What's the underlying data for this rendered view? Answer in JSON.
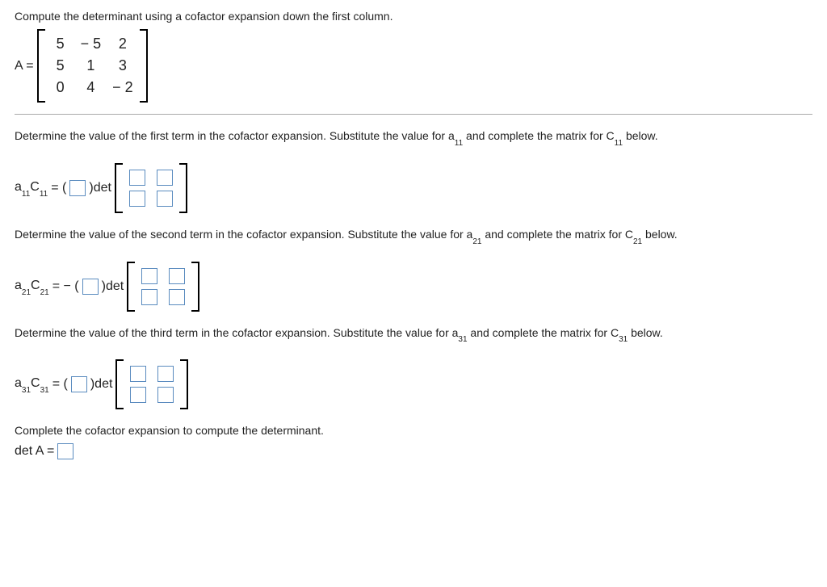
{
  "instruction": "Compute the determinant using a cofactor expansion down the first column.",
  "A_label": "A =",
  "A_matrix": [
    [
      "5",
      "− 5",
      "2"
    ],
    [
      "5",
      "1",
      "3"
    ],
    [
      "0",
      "4",
      "− 2"
    ]
  ],
  "step1_text_a": "Determine the value of the first term in the cofactor expansion. Substitute the value for a",
  "step1_sub": "11",
  "step1_text_b": " and complete the matrix for C",
  "step1_sub2": "11",
  "step1_text_c": " below.",
  "eq1_lhs_a": "a",
  "eq1_lhs_sub1": "11",
  "eq1_lhs_c": "C",
  "eq1_lhs_sub2": "11",
  "eq1_mid": " = (",
  "eq1_close": ")det",
  "step2_text_a": "Determine the value of the second term in the cofactor expansion. Substitute the value for a",
  "step2_sub": "21",
  "step2_text_b": " and complete the matrix for C",
  "step2_sub2": "21",
  "step2_text_c": " below.",
  "eq2_lhs_a": "a",
  "eq2_lhs_sub1": "21",
  "eq2_lhs_c": "C",
  "eq2_lhs_sub2": "21",
  "eq2_mid": " = − (",
  "eq2_close": ")det",
  "step3_text_a": "Determine the value of the third term in the cofactor expansion. Substitute the value for a",
  "step3_sub": "31",
  "step3_text_b": " and complete the matrix for C",
  "step3_sub2": "31",
  "step3_text_c": " below.",
  "eq3_lhs_a": "a",
  "eq3_lhs_sub1": "31",
  "eq3_lhs_c": "C",
  "eq3_lhs_sub2": "31",
  "eq3_mid": " = (",
  "eq3_close": ")det",
  "final_text": "Complete the cofactor expansion to compute the determinant.",
  "final_lhs": "det A ="
}
